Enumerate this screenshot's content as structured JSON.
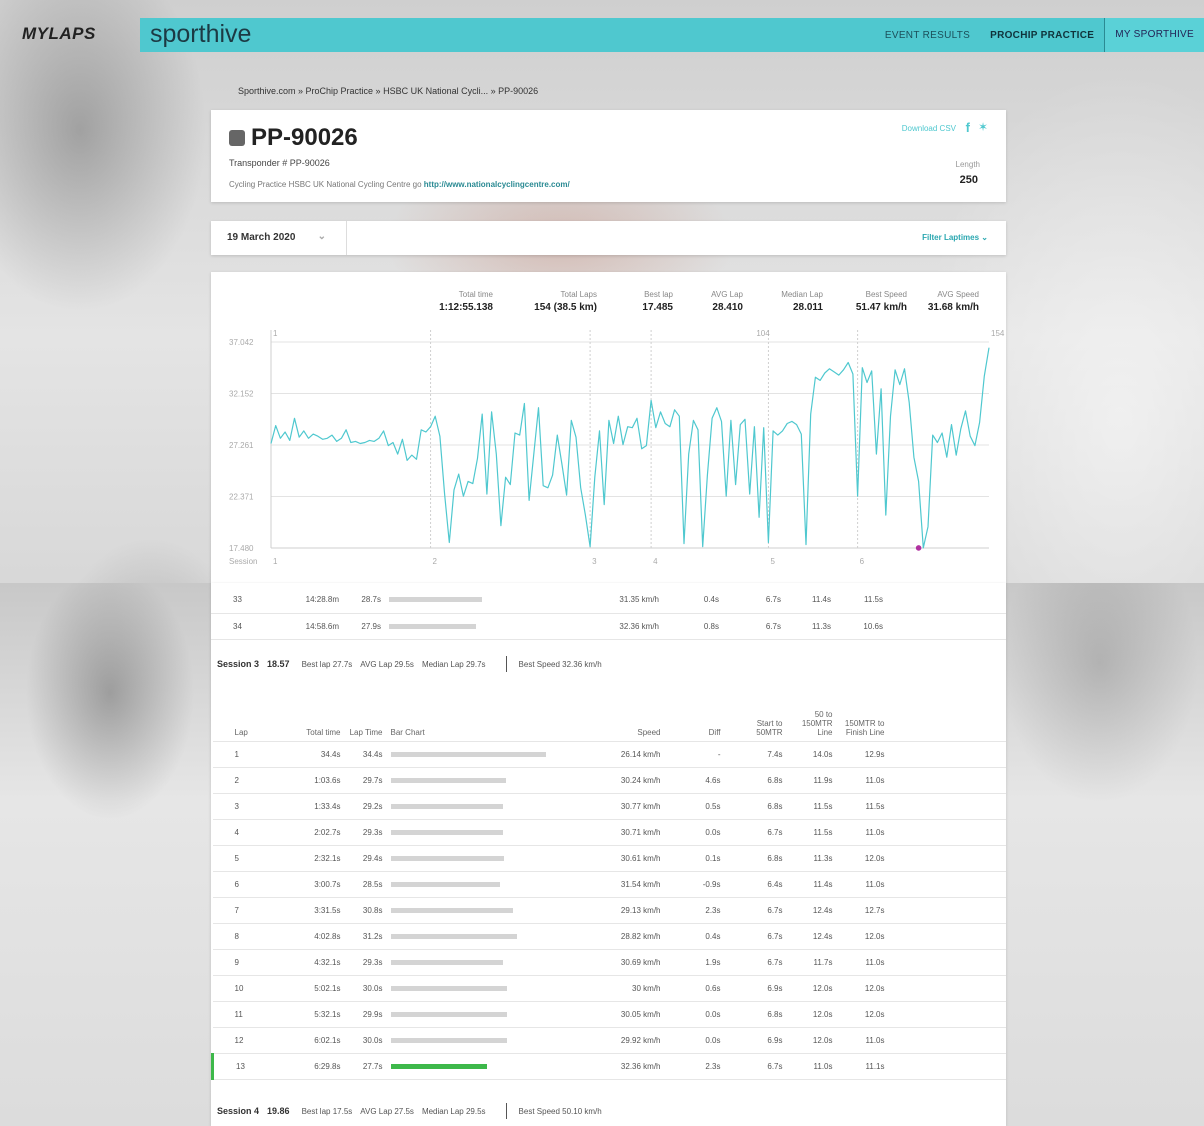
{
  "brand": {
    "mylaps": "MYLAPS",
    "sporthive": "sporthive"
  },
  "nav": [
    {
      "label": "EVENT RESULTS"
    },
    {
      "label": "PROCHIP PRACTICE"
    },
    {
      "label": "MY SPORTHIVE"
    }
  ],
  "breadcrumb": "Sporthive.com » ProChip Practice » HSBC UK National Cycli... » PP-90026",
  "header": {
    "title": "PP-90026",
    "transponder": "Transponder # PP-90026",
    "description": "Cycling Practice HSBC UK National Cycling Centre go",
    "link": "http://www.nationalcyclingcentre.com/",
    "download": "Download CSV",
    "facebook_icon": "facebook-icon",
    "twitter_icon": "twitter-icon",
    "length_label": "Length",
    "length_value": "250"
  },
  "filter": {
    "date": "19 March 2020",
    "filter_label": "Filter Laptimes"
  },
  "stats": [
    {
      "label": "Total time",
      "value": "1:12:55.138"
    },
    {
      "label": "Total Laps",
      "value": "154 (38.5 km)"
    },
    {
      "label": "Best lap",
      "value": "17.485"
    },
    {
      "label": "AVG Lap",
      "value": "28.410"
    },
    {
      "label": "Median Lap",
      "value": "28.011"
    },
    {
      "label": "Best Speed",
      "value": "51.47 km/h"
    },
    {
      "label": "AVG Speed",
      "value": "31.68 km/h"
    }
  ],
  "chart_data": {
    "type": "line",
    "y_ticks": [
      "37.042",
      "32.152",
      "27.261",
      "22.371",
      "17.480"
    ],
    "ylim": [
      17.48,
      37.042
    ],
    "x_label": "Session",
    "session_ticks": [
      {
        "label": "1",
        "lap": 1
      },
      {
        "label": "2",
        "lap": 35
      },
      {
        "label": "3",
        "lap": 69
      },
      {
        "label": "4",
        "lap": 82
      },
      {
        "label": "5",
        "lap": 107
      },
      {
        "label": "6",
        "lap": 126
      }
    ],
    "top_labels": [
      {
        "label": "1",
        "lap": 1
      },
      {
        "label": "104",
        "lap": 104
      },
      {
        "label": "154",
        "lap": 154
      }
    ],
    "series": [
      {
        "color": "#4fc8cf",
        "values": [
          27.4,
          29.1,
          27.9,
          28.5,
          27.7,
          29.8,
          28.0,
          28.6,
          27.9,
          28.3,
          28.1,
          27.8,
          27.9,
          28.2,
          27.6,
          27.9,
          28.7,
          27.5,
          27.6,
          27.4,
          27.5,
          27.7,
          27.6,
          27.9,
          28.6,
          27.2,
          27.5,
          26.4,
          27.8,
          25.8,
          26.3,
          25.9,
          28.7,
          28.5,
          29.0,
          30.0,
          28.1,
          22.6,
          18.0,
          23.0,
          24.5,
          22.4,
          23.8,
          23.6,
          26.0,
          30.2,
          22.6,
          30.4,
          26.4,
          19.6,
          24.2,
          23.5,
          28.4,
          28.2,
          31.2,
          22.0,
          26.4,
          30.8,
          23.4,
          23.2,
          24.4,
          28.2,
          25.4,
          22.5,
          29.6,
          28.0,
          23.2,
          20.6,
          17.6,
          24.2,
          28.6,
          21.6,
          29.6,
          27.4,
          30.0,
          27.3,
          29.0,
          28.9,
          29.8,
          26.9,
          27.2,
          31.5,
          28.9,
          30.4,
          29.3,
          29.0,
          30.6,
          30.0,
          17.9,
          26.4,
          29.6,
          28.7,
          17.6,
          24.4,
          29.8,
          30.8,
          29.5,
          22.4,
          29.6,
          23.5,
          29.2,
          29.7,
          22.6,
          29.0,
          20.4,
          28.9,
          18.0,
          28.6,
          28.2,
          28.6,
          29.3,
          29.5,
          29.2,
          28.3,
          17.8,
          30.2,
          33.7,
          33.4,
          34.1,
          34.5,
          34.2,
          33.9,
          34.4,
          35.1,
          34.0,
          22.4,
          34.6,
          33.2,
          34.3,
          26.4,
          32.6,
          20.6,
          30.0,
          34.4,
          33.0,
          34.5,
          31.3,
          26.1,
          23.8,
          17.485,
          19.5,
          28.2,
          27.5,
          28.4,
          26.1,
          29.2,
          26.3,
          28.8,
          30.5,
          28.1,
          27.2,
          29.4,
          33.8,
          36.5
        ]
      }
    ],
    "best_lap_marker": {
      "lap": 139,
      "value": 17.485,
      "color": "#b030a0"
    }
  },
  "session3_top_rows": [
    {
      "lap": "33",
      "total": "14:28.8m",
      "laptime": "28.7s",
      "bar": 0.6,
      "speed": "31.35 km/h",
      "diff": "0.4s",
      "start": "6.7s",
      "mid": "11.4s",
      "finish": "11.5s"
    },
    {
      "lap": "34",
      "total": "14:58.6m",
      "laptime": "27.9s",
      "bar": 0.56,
      "speed": "32.36 km/h",
      "diff": "0.8s",
      "start": "6.7s",
      "mid": "11.3s",
      "finish": "10.6s"
    }
  ],
  "session3": {
    "name": "Session 3",
    "time": "18.57",
    "best_lap": "Best lap 27.7s",
    "avg_lap": "AVG Lap 29.5s",
    "median_lap": "Median Lap 29.7s",
    "best_speed": "Best Speed 32.36 km/h"
  },
  "columns": {
    "lap": "Lap",
    "total": "Total time",
    "laptime": "Lap Time",
    "bar": "Bar Chart",
    "speed": "Speed",
    "diff": "Diff",
    "start": "Start to 50MTR",
    "mid": "50 to 150MTR Line",
    "finish": "150MTR to Finish Line"
  },
  "rows": [
    {
      "lap": "1",
      "total": "34.4s",
      "laptime": "34.4s",
      "bar": 1.0,
      "speed": "26.14 km/h",
      "diff": "-",
      "start": "7.4s",
      "mid": "14.0s",
      "finish": "12.9s"
    },
    {
      "lap": "2",
      "total": "1:03.6s",
      "laptime": "29.7s",
      "bar": 0.74,
      "speed": "30.24 km/h",
      "diff": "4.6s",
      "start": "6.8s",
      "mid": "11.9s",
      "finish": "11.0s"
    },
    {
      "lap": "3",
      "total": "1:33.4s",
      "laptime": "29.2s",
      "bar": 0.72,
      "speed": "30.77 km/h",
      "diff": "0.5s",
      "start": "6.8s",
      "mid": "11.5s",
      "finish": "11.5s"
    },
    {
      "lap": "4",
      "total": "2:02.7s",
      "laptime": "29.3s",
      "bar": 0.72,
      "speed": "30.71 km/h",
      "diff": "0.0s",
      "start": "6.7s",
      "mid": "11.5s",
      "finish": "11.0s"
    },
    {
      "lap": "5",
      "total": "2:32.1s",
      "laptime": "29.4s",
      "bar": 0.73,
      "speed": "30.61 km/h",
      "diff": "0.1s",
      "start": "6.8s",
      "mid": "11.3s",
      "finish": "12.0s"
    },
    {
      "lap": "6",
      "total": "3:00.7s",
      "laptime": "28.5s",
      "bar": 0.7,
      "speed": "31.54 km/h",
      "diff": "-0.9s",
      "start": "6.4s",
      "mid": "11.4s",
      "finish": "11.0s"
    },
    {
      "lap": "7",
      "total": "3:31.5s",
      "laptime": "30.8s",
      "bar": 0.79,
      "speed": "29.13 km/h",
      "diff": "2.3s",
      "start": "6.7s",
      "mid": "12.4s",
      "finish": "12.7s"
    },
    {
      "lap": "8",
      "total": "4:02.8s",
      "laptime": "31.2s",
      "bar": 0.81,
      "speed": "28.82 km/h",
      "diff": "0.4s",
      "start": "6.7s",
      "mid": "12.4s",
      "finish": "12.0s"
    },
    {
      "lap": "9",
      "total": "4:32.1s",
      "laptime": "29.3s",
      "bar": 0.72,
      "speed": "30.69 km/h",
      "diff": "1.9s",
      "start": "6.7s",
      "mid": "11.7s",
      "finish": "11.0s"
    },
    {
      "lap": "10",
      "total": "5:02.1s",
      "laptime": "30.0s",
      "bar": 0.75,
      "speed": "30 km/h",
      "diff": "0.6s",
      "start": "6.9s",
      "mid": "12.0s",
      "finish": "12.0s"
    },
    {
      "lap": "11",
      "total": "5:32.1s",
      "laptime": "29.9s",
      "bar": 0.75,
      "speed": "30.05 km/h",
      "diff": "0.0s",
      "start": "6.8s",
      "mid": "12.0s",
      "finish": "12.0s"
    },
    {
      "lap": "12",
      "total": "6:02.1s",
      "laptime": "30.0s",
      "bar": 0.75,
      "speed": "29.92 km/h",
      "diff": "0.0s",
      "start": "6.9s",
      "mid": "12.0s",
      "finish": "11.0s"
    },
    {
      "lap": "13",
      "total": "6:29.8s",
      "laptime": "27.7s",
      "bar": 0.62,
      "speed": "32.36 km/h",
      "diff": "2.3s",
      "start": "6.7s",
      "mid": "11.0s",
      "finish": "11.1s",
      "best": true
    }
  ],
  "session4": {
    "name": "Session 4",
    "time": "19.86",
    "best_lap": "Best lap 17.5s",
    "avg_lap": "AVG Lap 27.5s",
    "median_lap": "Median Lap 29.5s",
    "best_speed": "Best Speed 50.10 km/h"
  }
}
